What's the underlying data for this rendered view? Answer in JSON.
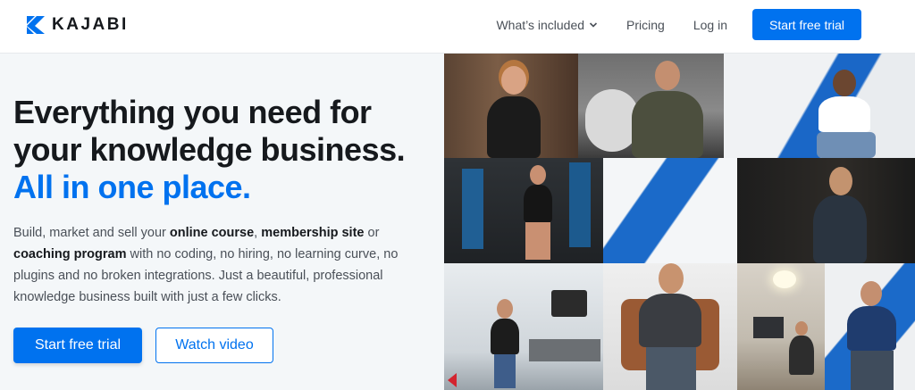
{
  "header": {
    "logo_text": "KAJABI",
    "logo_icon": "kajabi-k-logo",
    "nav": {
      "whats_included": "What’s included",
      "pricing": "Pricing",
      "login": "Log in",
      "cta": "Start free trial"
    }
  },
  "hero": {
    "headline_line1": "Everything you need for",
    "headline_line2": "your knowledge business.",
    "headline_accent": "All in one place.",
    "body": {
      "t1": "Build, market and sell your ",
      "b1": "online course",
      "t2": ", ",
      "b2": "membership site",
      "t3": " or ",
      "b3": "coaching program",
      "t4": " with no coding, no hiring, no learning curve, no plugins and no broken integrations. Just a beautiful, professional knowledge business built with just a few clicks."
    },
    "primary_cta": "Start free trial",
    "secondary_cta": "Watch video"
  },
  "colors": {
    "brand_blue": "#0072ef",
    "text_dark": "#16191d",
    "text_muted": "#4a5058",
    "hero_bg": "#f4f7f9"
  }
}
